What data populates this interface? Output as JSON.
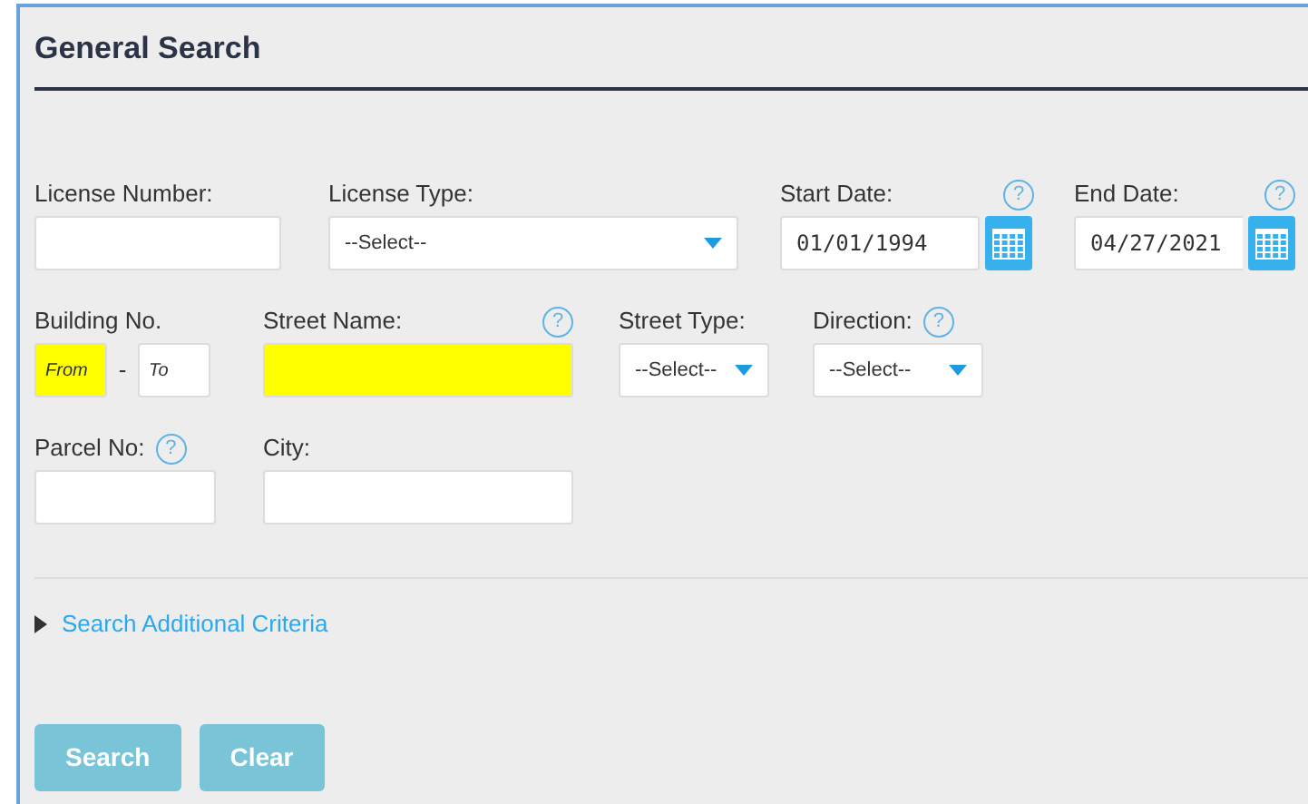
{
  "title": "General Search",
  "row1": {
    "license_number": {
      "label": "License Number:"
    },
    "license_type": {
      "label": "License Type:",
      "value": "--Select--"
    },
    "start_date": {
      "label": "Start Date:",
      "help": "?",
      "value": "01/01/1994"
    },
    "end_date": {
      "label": "End Date:",
      "help": "?",
      "value": "04/27/2021"
    }
  },
  "row2": {
    "building_no": {
      "label": "Building No.",
      "from": {
        "placeholder": "From",
        "highlighted": true
      },
      "separator": "-",
      "to": {
        "placeholder": "To",
        "highlighted": false
      }
    },
    "street_name": {
      "label": "Street Name:",
      "help": "?",
      "highlighted": true
    },
    "street_type": {
      "label": "Street Type:",
      "value": "--Select--"
    },
    "direction": {
      "label": "Direction:",
      "help": "?",
      "value": "--Select--"
    }
  },
  "row3": {
    "parcel_no": {
      "label": "Parcel No:",
      "help": "?"
    },
    "city": {
      "label": "City:"
    }
  },
  "additional_criteria": {
    "label": "Search Additional Criteria",
    "expanded": false
  },
  "buttons": [
    {
      "label": "Search",
      "disabled": true
    },
    {
      "label": "Clear",
      "disabled": true
    }
  ]
}
